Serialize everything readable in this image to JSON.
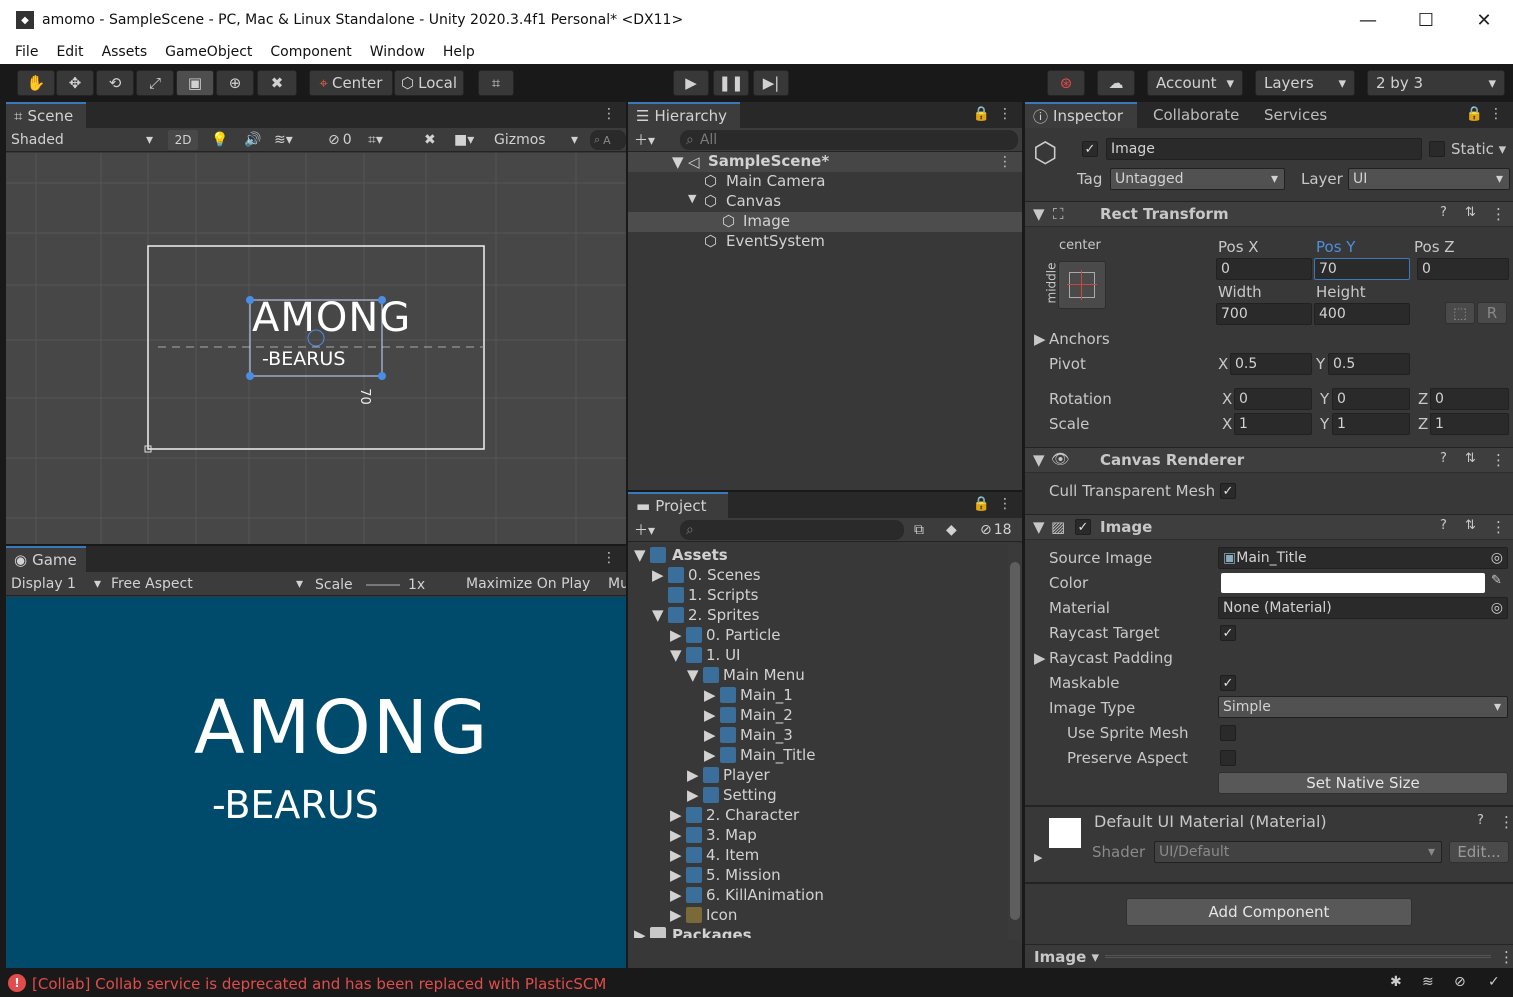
{
  "window": {
    "title": "amomo - SampleScene - PC, Mac & Linux Standalone - Unity 2020.3.4f1 Personal* <DX11>"
  },
  "menu": [
    "File",
    "Edit",
    "Assets",
    "GameObject",
    "Component",
    "Window",
    "Help"
  ],
  "toolbar": {
    "center": "Center",
    "local": "Local",
    "account": "Account",
    "layers": "Layers",
    "layout": "2 by 3"
  },
  "scene": {
    "tab": "Scene",
    "shading": "Shaded",
    "mode2d": "2D",
    "hidden_count": "0",
    "gizmos": "Gizmos",
    "search_short": "A",
    "y_label": "70",
    "logo_line1": "AMONG",
    "logo_line2": "-BEARUS"
  },
  "game": {
    "tab": "Game",
    "display": "Display 1",
    "aspect": "Free Aspect",
    "scale_label": "Scale",
    "scale_value": "1x",
    "maximize": "Maximize On Play",
    "mute_short": "Mu",
    "logo_line1": "AMONG",
    "logo_line2": "-BEARUS"
  },
  "hierarchy": {
    "tab": "Hierarchy",
    "search_placeholder": "All",
    "items": [
      "SampleScene*",
      "Main Camera",
      "Canvas",
      "Image",
      "EventSystem"
    ]
  },
  "project": {
    "tab": "Project",
    "hidden_count": "18",
    "items": [
      "Assets",
      "0. Scenes",
      "1. Scripts",
      "2. Sprites",
      "0. Particle",
      "1. UI",
      "Main Menu",
      "Main_1",
      "Main_2",
      "Main_3",
      "Main_Title",
      "Player",
      "Setting",
      "2. Character",
      "3. Map",
      "4. Item",
      "5. Mission",
      "6. KillAnimation",
      "Icon",
      "Packages"
    ]
  },
  "inspector": {
    "tabs": [
      "Inspector",
      "Collaborate",
      "Services"
    ],
    "name": "Image",
    "static_label": "Static",
    "tag_label": "Tag",
    "tag_value": "Untagged",
    "layer_label": "Layer",
    "layer_value": "UI",
    "rect": {
      "title": "Rect Transform",
      "anchor_h": "center",
      "anchor_v": "middle",
      "posx_label": "Pos X",
      "posy_label": "Pos Y",
      "posz_label": "Pos Z",
      "posx": "0",
      "posy": "70",
      "posz": "0",
      "width_label": "Width",
      "height_label": "Height",
      "width": "700",
      "height": "400",
      "raw_btn": "R",
      "anchors": "Anchors",
      "pivot": "Pivot",
      "pivot_x": "0.5",
      "pivot_y": "0.5",
      "rotation": "Rotation",
      "rot_x": "0",
      "rot_y": "0",
      "rot_z": "0",
      "scale": "Scale",
      "sc_x": "1",
      "sc_y": "1",
      "sc_z": "1",
      "x": "X",
      "y": "Y",
      "z": "Z"
    },
    "canvas_renderer": {
      "title": "Canvas Renderer",
      "cull": "Cull Transparent Mesh"
    },
    "image": {
      "title": "Image",
      "source_image_label": "Source Image",
      "source_image": "Main_Title",
      "color_label": "Color",
      "material_label": "Material",
      "material": "None (Material)",
      "raycast_target": "Raycast Target",
      "raycast_padding": "Raycast Padding",
      "maskable": "Maskable",
      "image_type_label": "Image Type",
      "image_type": "Simple",
      "use_sprite_mesh": "Use Sprite Mesh",
      "preserve_aspect": "Preserve Aspect",
      "set_native": "Set Native Size"
    },
    "material_block": {
      "title": "Default UI Material (Material)",
      "shader_label": "Shader",
      "shader": "UI/Default",
      "edit": "Edit..."
    },
    "add_component": "Add Component",
    "footer": "Image"
  },
  "status": {
    "message": "[Collab] Collab service is deprecated and has been replaced with PlasticSCM"
  },
  "colors": {
    "accent": "#3a79bb",
    "scene_bg": "#474747",
    "game_bg": "#004b6b",
    "error": "#e14c4c"
  }
}
